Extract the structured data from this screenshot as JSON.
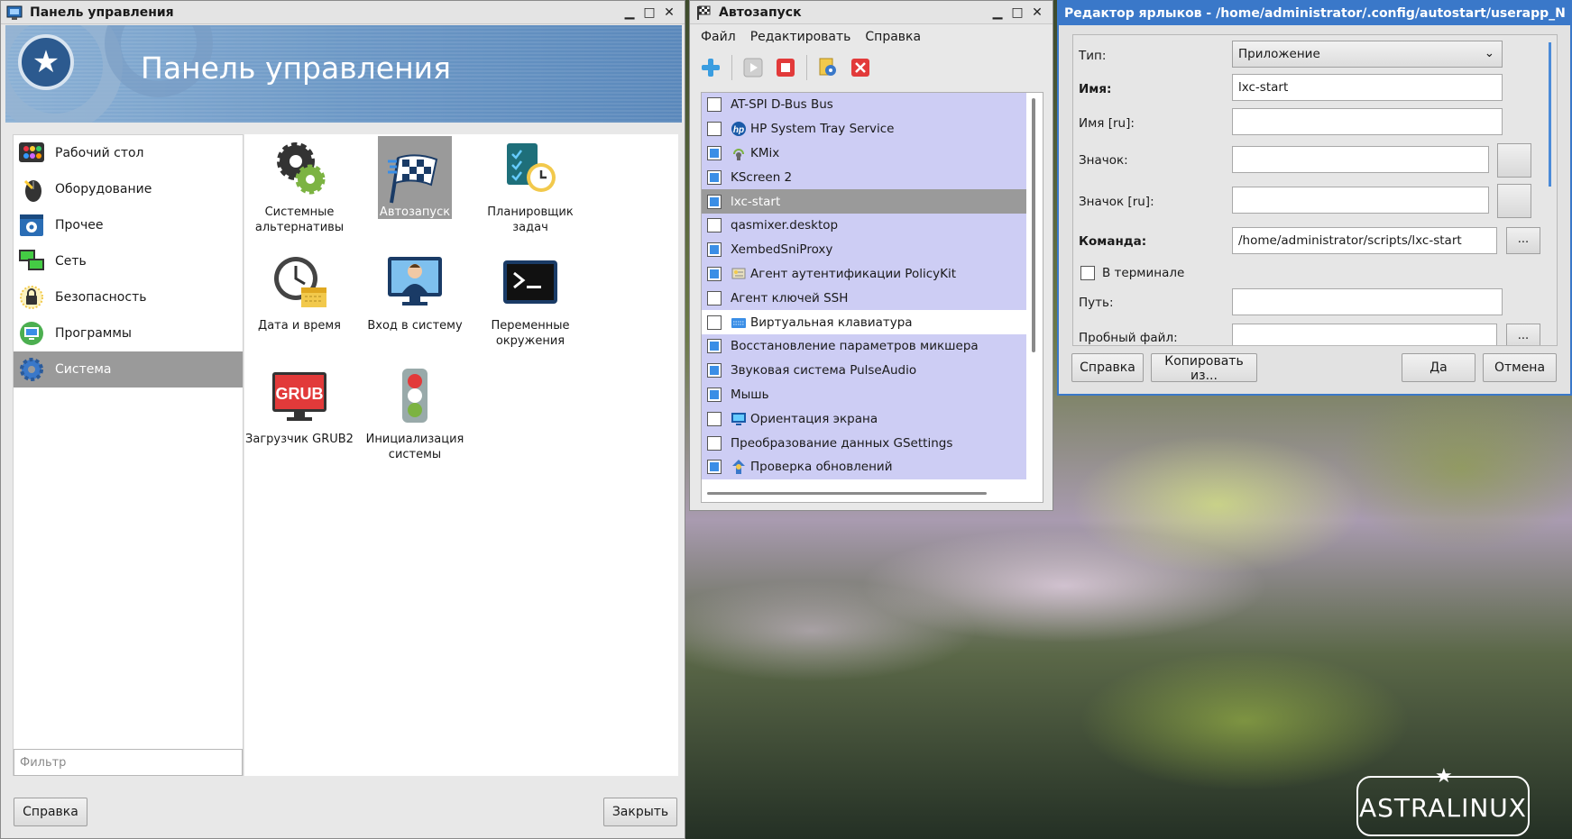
{
  "control_panel": {
    "title": "Панель управления",
    "banner_title": "Панель управления",
    "sidebar": [
      {
        "label": "Рабочий стол",
        "icon": "desktop-icon"
      },
      {
        "label": "Оборудование",
        "icon": "mouse-icon"
      },
      {
        "label": "Прочее",
        "icon": "settings-window-icon"
      },
      {
        "label": "Сеть",
        "icon": "network-icon"
      },
      {
        "label": "Безопасность",
        "icon": "security-lock-icon"
      },
      {
        "label": "Программы",
        "icon": "monitor-icon"
      },
      {
        "label": "Система",
        "icon": "gear-icon",
        "active": true
      }
    ],
    "apps": [
      {
        "label": "Системные альтернативы",
        "icon": "gears-icon"
      },
      {
        "label": "Автозапуск",
        "icon": "checkered-flag-icon",
        "active": true
      },
      {
        "label": "Планировщик задач",
        "icon": "clipboard-clock-icon"
      },
      {
        "label": "Дата и время",
        "icon": "clock-calendar-icon"
      },
      {
        "label": "Вход в систему",
        "icon": "user-monitor-icon"
      },
      {
        "label": "Переменные окружения",
        "icon": "terminal-icon"
      },
      {
        "label": "Загрузчик GRUB2",
        "icon": "grub-icon",
        "badge": "GRUB"
      },
      {
        "label": "Инициализация системы",
        "icon": "traffic-light-icon"
      }
    ],
    "filter_placeholder": "Фильтр",
    "help_button": "Справка",
    "close_button": "Закрыть"
  },
  "autostart": {
    "title": "Автозапуск",
    "menu": [
      "Файл",
      "Редактировать",
      "Справка"
    ],
    "items": [
      {
        "label": "AT-SPI D-Bus Bus",
        "checked": false,
        "icon": ""
      },
      {
        "label": "HP System Tray Service",
        "checked": false,
        "icon": "hp-icon"
      },
      {
        "label": "KMix",
        "checked": true,
        "icon": "speaker-icon"
      },
      {
        "label": "KScreen 2",
        "checked": true,
        "icon": ""
      },
      {
        "label": "lxc-start",
        "checked": true,
        "icon": "",
        "selected": true
      },
      {
        "label": "qasmixer.desktop",
        "checked": false,
        "icon": ""
      },
      {
        "label": "XembedSniProxy",
        "checked": true,
        "icon": ""
      },
      {
        "label": "Агент аутентификации PolicyKit",
        "checked": true,
        "icon": "policykit-icon"
      },
      {
        "label": "Агент ключей SSH",
        "checked": false,
        "icon": ""
      },
      {
        "label": "Виртуальная клавиатура",
        "checked": false,
        "icon": "keyboard-icon",
        "white": true
      },
      {
        "label": "Восстановление параметров микшера",
        "checked": true,
        "icon": ""
      },
      {
        "label": "Звуковая система PulseAudio",
        "checked": true,
        "icon": ""
      },
      {
        "label": "Мышь",
        "checked": true,
        "icon": ""
      },
      {
        "label": "Ориентация экрана",
        "checked": false,
        "icon": "display-icon"
      },
      {
        "label": "Преобразование данных GSettings",
        "checked": false,
        "icon": ""
      },
      {
        "label": "Проверка обновлений",
        "checked": true,
        "icon": "update-icon"
      }
    ]
  },
  "editor": {
    "title": "Редактор ярлыков - /home/administrator/.config/autostart/userapp_NyyzWL...",
    "type_label": "Тип:",
    "type_value": "Приложение",
    "name_label": "Имя:",
    "name_value": "lxc-start",
    "name_ru_label": "Имя [ru]:",
    "icon_label": "Значок:",
    "icon_ru_label": "Значок [ru]:",
    "command_label": "Команда:",
    "command_value": "/home/administrator/scripts/lxc-start",
    "browse": "...",
    "terminal_label": "В терминале",
    "path_label": "Путь:",
    "tryexec_label": "Пробный файл:",
    "help_button": "Справка",
    "copy_button": "Копировать из...",
    "ok_button": "Да",
    "cancel_button": "Отмена"
  },
  "desktop": {
    "logo_text": "ASTRALINUX"
  },
  "colors": {
    "selection_bg": "#9a9a9a",
    "list_highlight": "#cdcdf4",
    "editor_titlebar": "#3a78c9",
    "checkbox_on": "#3a8ee6"
  }
}
